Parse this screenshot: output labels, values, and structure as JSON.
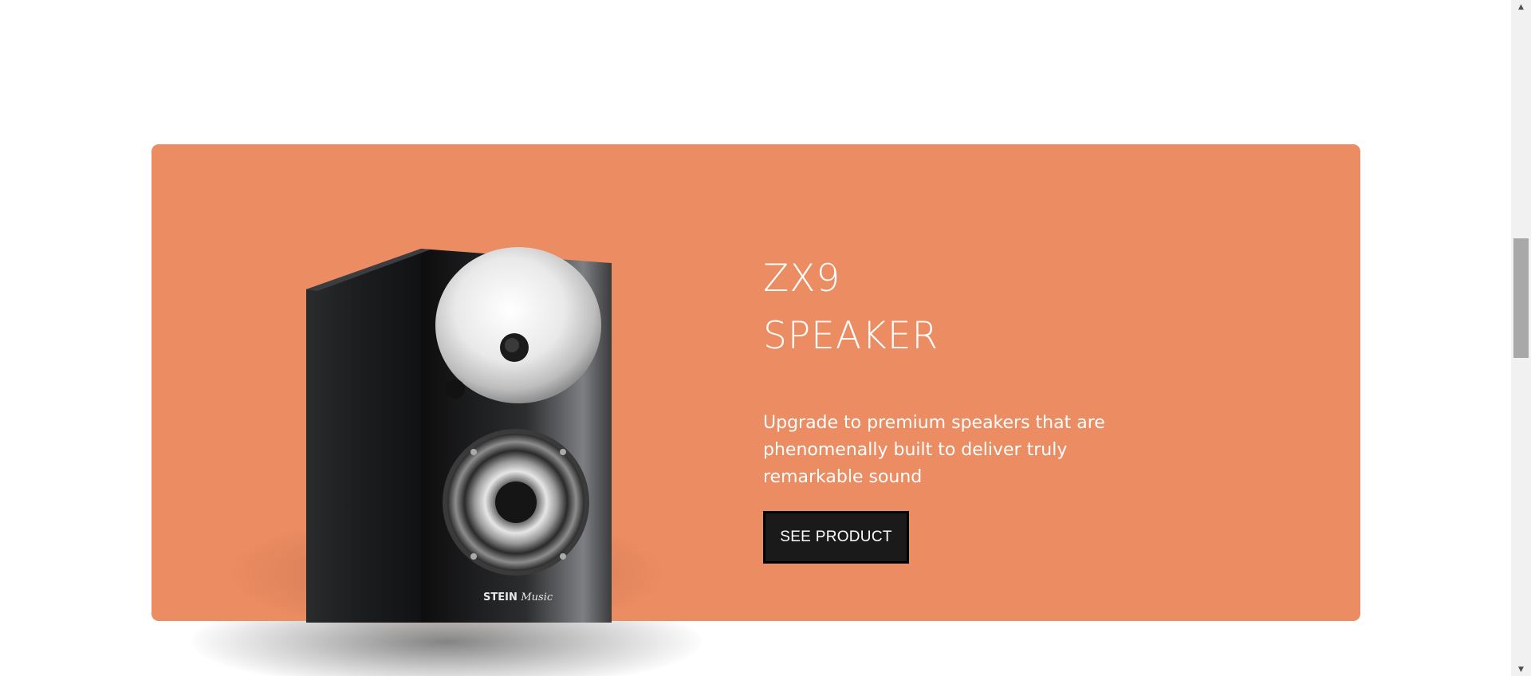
{
  "promo": {
    "title_line1": "ZX9",
    "title_line2": "SPEAKER",
    "description": "Upgrade to premium speakers that are phenomenally built to deliver truly remarkable sound",
    "button_label": "SEE PRODUCT",
    "brand_mark": "STEIN Music"
  },
  "scrollbar": {
    "up_arrow": "▲",
    "down_arrow": "▼"
  },
  "colors": {
    "card_background": "#ec8c62",
    "button_background": "#1a1a1a",
    "text": "#ffffff"
  }
}
